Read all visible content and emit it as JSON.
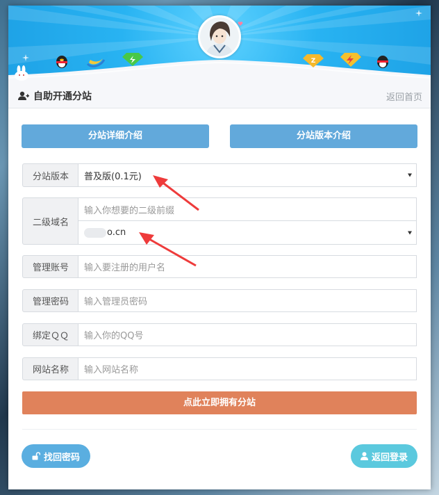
{
  "header": {
    "title": "自助开通分站",
    "back_home": "返回首页"
  },
  "intro_buttons": {
    "detail": "分站详细介绍",
    "version": "分站版本介绍"
  },
  "form": {
    "version": {
      "label": "分站版本",
      "selected": "普及版(0.1元)"
    },
    "subdomain": {
      "label": "二级域名",
      "placeholder": "输入你想要的二级前缀",
      "domain_selected": "o.cn"
    },
    "admin_account": {
      "label": "管理账号",
      "placeholder": "输入要注册的用户名"
    },
    "admin_password": {
      "label": "管理密码",
      "placeholder": "输入管理员密码"
    },
    "bind_qq": {
      "label": "绑定ＱＱ",
      "placeholder": "输入你的QQ号"
    },
    "site_name": {
      "label": "网站名称",
      "placeholder": "输入网站名称"
    },
    "submit_label": "点此立即拥有分站"
  },
  "footer": {
    "find_password": "找回密码",
    "back_login": "返回登录"
  },
  "colors": {
    "banner": "#28b3f2",
    "intro_button": "#62a9db",
    "submit": "#e0825b",
    "find_password": "#5aaee0",
    "back_login": "#5bc9de",
    "arrow": "#ee3b3b"
  }
}
